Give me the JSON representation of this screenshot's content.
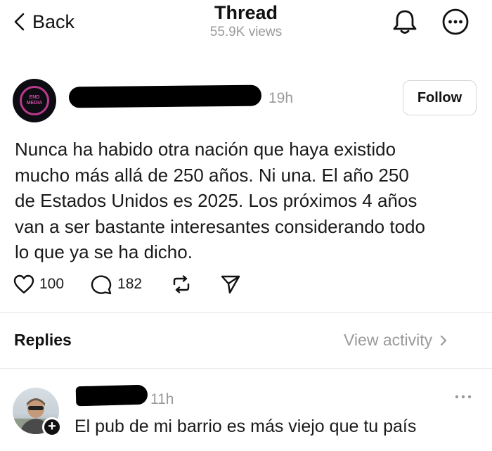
{
  "header": {
    "back_label": "Back",
    "title": "Thread",
    "views": "55.9K views"
  },
  "post": {
    "avatar_text": "END MEDIA",
    "time": "19h",
    "follow_label": "Follow",
    "body": "Nunca ha habido otra nación que haya existido\nmucho más allá de 250 años. Ni una. El año 250\nde Estados Unidos es 2025. Los próximos 4 años\nvan a ser bastante interesantes considerando todo\nlo que ya se ha dicho.",
    "likes": "100",
    "comments": "182"
  },
  "replies_section": {
    "label": "Replies",
    "view_activity": "View activity"
  },
  "reply": {
    "time": "11h",
    "text": "El pub de mi barrio es más viejo que tu país"
  },
  "icons": {
    "back": "chevron-left-icon",
    "notifications": "bell-icon",
    "more": "ellipsis-circle-icon",
    "like": "heart-icon",
    "comment": "speech-bubble-icon",
    "repost": "repost-icon",
    "share": "send-icon"
  }
}
